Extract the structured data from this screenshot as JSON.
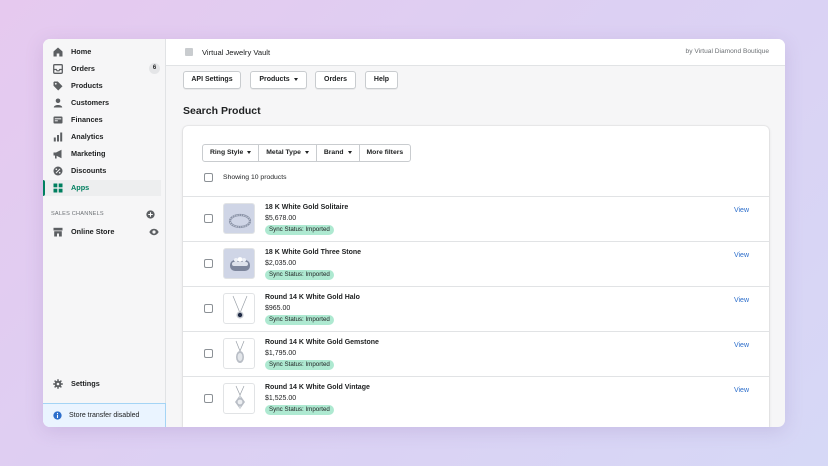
{
  "sidebar": {
    "items": [
      {
        "label": "Home",
        "icon": "home-icon"
      },
      {
        "label": "Orders",
        "icon": "orders-icon",
        "badge": "6"
      },
      {
        "label": "Products",
        "icon": "tag-icon"
      },
      {
        "label": "Customers",
        "icon": "person-icon"
      },
      {
        "label": "Finances",
        "icon": "finances-icon"
      },
      {
        "label": "Analytics",
        "icon": "bar-chart-icon"
      },
      {
        "label": "Marketing",
        "icon": "megaphone-icon"
      },
      {
        "label": "Discounts",
        "icon": "discount-icon"
      },
      {
        "label": "Apps",
        "icon": "apps-icon",
        "active": true
      }
    ],
    "sales_channels_label": "SALES CHANNELS",
    "online_store_label": "Online Store",
    "settings_label": "Settings",
    "store_note": "Store transfer disabled"
  },
  "header": {
    "app_title": "Virtual Jewelry Vault",
    "byline": "by Virtual Diamond Boutique"
  },
  "toolbar": {
    "api_settings": "API Settings",
    "products": "Products",
    "orders": "Orders",
    "help": "Help"
  },
  "page": {
    "title": "Search Product"
  },
  "filters": {
    "ring_style": "Ring Style",
    "metal_type": "Metal Type",
    "brand": "Brand",
    "more": "More filters"
  },
  "list": {
    "showing": "Showing 10 products",
    "view_label": "View",
    "products": [
      {
        "name": "18 K White Gold Solitaire",
        "price": "$5,678.00",
        "status": "Sync Status: Imported",
        "thumb": "ring-solitaire"
      },
      {
        "name": "18 K White Gold Three Stone",
        "price": "$2,035.00",
        "status": "Sync Status: Imported",
        "thumb": "ring-three-stone"
      },
      {
        "name": "Round 14 K White Gold Halo",
        "price": "$965.00",
        "status": "Sync Status: Imported",
        "thumb": "pendant-halo"
      },
      {
        "name": "Round 14 K White Gold Gemstone",
        "price": "$1,795.00",
        "status": "Sync Status: Imported",
        "thumb": "pendant-gemstone"
      },
      {
        "name": "Round 14 K White Gold Vintage",
        "price": "$1,525.00",
        "status": "Sync Status: Imported",
        "thumb": "pendant-vintage"
      }
    ]
  },
  "colors": {
    "accent_green": "#008060",
    "badge_green": "#aee9d1",
    "link_blue": "#2c6ecb"
  }
}
